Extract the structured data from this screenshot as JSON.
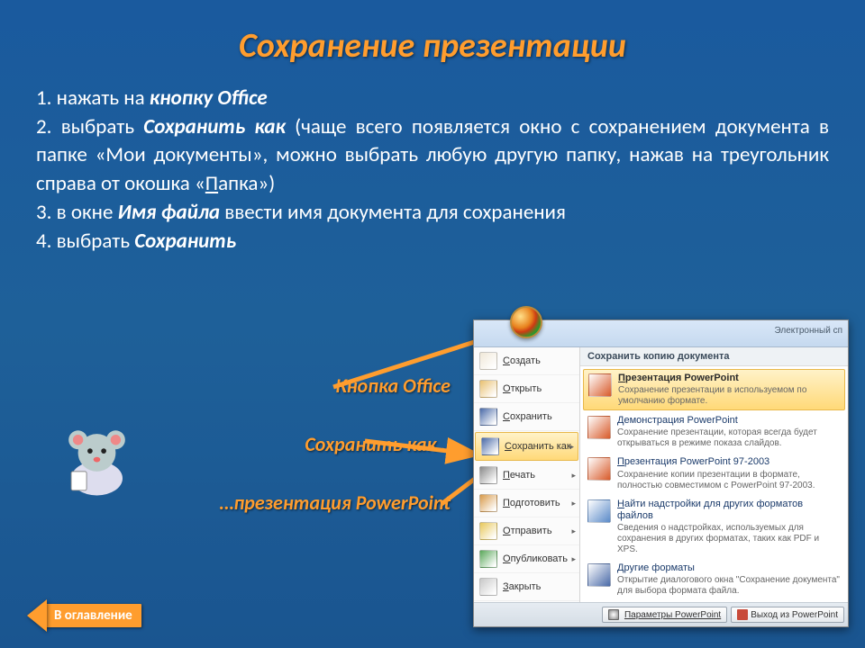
{
  "title": "Сохранение презентации",
  "steps": {
    "s1_prefix": "1. нажать на ",
    "s1_bold": "кнопку Office",
    "s2_prefix": "2. выбрать ",
    "s2_bold": "Сохранить как",
    "s2_rest": " (чаще всего появляется окно с сохранением документа в папке «Мои документы», можно выбрать любую другую папку, нажав на треугольник справа от окошка «",
    "s2_under": "П",
    "s2_rest2": "апка»)",
    "s3_prefix": "3. в окне ",
    "s3_bold": "Имя файла",
    "s3_rest": " ввести имя документа для сохранения",
    "s4_prefix": "4. выбрать ",
    "s4_bold": "Сохранить"
  },
  "labels": {
    "l1": "Кнопка Office",
    "l2": "Сохранить как…",
    "l3": "…презентация PowerPoint"
  },
  "office": {
    "top_right": "Электронный сп",
    "left_items": [
      {
        "label": "Создать",
        "color": "#f0e8d8"
      },
      {
        "label": "Открыть",
        "color": "#e8c070"
      },
      {
        "label": "Сохранить",
        "color": "#4a6aa8"
      },
      {
        "label": "Сохранить как",
        "color": "#4a6aa8",
        "selected": true,
        "chev": true
      },
      {
        "label": "Печать",
        "color": "#8a8a8a",
        "chev": true
      },
      {
        "label": "Подготовить",
        "color": "#d89a4a",
        "chev": true
      },
      {
        "label": "Отправить",
        "color": "#e8c85a",
        "chev": true
      },
      {
        "label": "Опубликовать",
        "color": "#5aa85a",
        "chev": true
      },
      {
        "label": "Закрыть",
        "color": "#c8c8c8"
      }
    ],
    "right_header": "Сохранить копию документа",
    "right_items": [
      {
        "t1": "Презентация PowerPoint",
        "t2": "Сохранение презентации в используемом по умолчанию формате.",
        "color": "#d85a2a",
        "selected": true,
        "under": true
      },
      {
        "t1": "Демонстрация PowerPoint",
        "t2": "Сохранение презентации, которая всегда будет открываться в режиме показа слайдов.",
        "color": "#d85a2a",
        "under": true
      },
      {
        "t1": "Презентация PowerPoint 97-2003",
        "t2": "Сохранение копии презентации в формате, полностью совместимом с PowerPoint 97-2003.",
        "color": "#d85a2a",
        "under": true
      },
      {
        "t1": "Найти надстройки для других форматов файлов",
        "t2": "Сведения о надстройках, используемых для сохранения в других форматах, таких как PDF и XPS.",
        "color": "#5a8ac8",
        "under": true
      },
      {
        "t1": "Другие форматы",
        "t2": "Открытие диалогового окна \"Сохранение документа\" для выбора формата файла.",
        "color": "#4a6aa8",
        "under": true
      }
    ],
    "footer": {
      "b1": "Параметры PowerPoint",
      "b2": "Выход из PowerPoint"
    }
  },
  "nav": "В оглавление"
}
